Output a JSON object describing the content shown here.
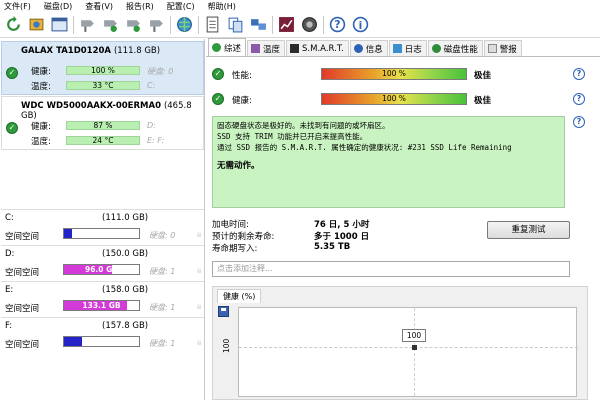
{
  "menu": [
    "文件(F)",
    "磁盘(D)",
    "查看(V)",
    "报告(R)",
    "配置(C)",
    "帮助(H)"
  ],
  "toolbar_icons": [
    "refresh-icon",
    "settings-icon",
    "window-icon",
    "tool1-icon",
    "tool2-icon",
    "tool3-icon",
    "tool4-icon",
    "globe-icon",
    "page-icon",
    "copy-icon",
    "network-icon",
    "chart-icon",
    "camera-icon",
    "help-icon",
    "info-icon"
  ],
  "disks": [
    {
      "name": "GALAX TA1D0120A",
      "size": "(111.8 GB)",
      "health_label": "健康:",
      "health": "100 %",
      "health_value": 100,
      "temp_label": "温度:",
      "temp": "33 °C",
      "note1": "硬盘: 0",
      "note2": "C:"
    },
    {
      "name": "WDC WD5000AAKX-00ERMA0",
      "size": "(465.8 GB)",
      "health_label": "健康:",
      "health": "87 %",
      "health_value": 87,
      "temp_label": "温度:",
      "temp": "24 °C",
      "note1": "D:",
      "note2": "E: F:"
    }
  ],
  "volumes": [
    {
      "letter": "C:",
      "capacity": "(111.0 GB)",
      "free_label": "空间空间",
      "free": "11.8 GB",
      "used_pct": 10,
      "color": "#2323c8",
      "note": "硬盘: 0"
    },
    {
      "letter": "D:",
      "capacity": "(150.0 GB)",
      "free_label": "空间空间",
      "free": "96.0 GB",
      "used_pct": 64,
      "color": "#d43ad8",
      "note": "硬盘: 1"
    },
    {
      "letter": "E:",
      "capacity": "(158.0 GB)",
      "free_label": "空间空间",
      "free": "133.1 GB",
      "used_pct": 84,
      "color": "#d43ad8",
      "note": "硬盘: 1"
    },
    {
      "letter": "F:",
      "capacity": "(157.8 GB)",
      "free_label": "空间空间",
      "free": "38.2 GB",
      "used_pct": 24,
      "color": "#2323c8",
      "note": "硬盘: 1"
    }
  ],
  "tabs": [
    "综述",
    "温度",
    "S.M.A.R.T.",
    "信息",
    "日志",
    "磁盘性能",
    "警报"
  ],
  "performance": {
    "label": "性能:",
    "value": "100 %",
    "level": 100,
    "verdict": "极佳"
  },
  "health": {
    "label": "健康:",
    "value": "100 %",
    "level": 100,
    "verdict": "极佳"
  },
  "message": {
    "line1": "固态硬盘状态是极好的。未找到有问题的或坏扇区。",
    "line2": "SSD 支持 TRIM 功能并已开启来提高性能。",
    "line3": "通过 SSD 报告的 S.M.A.R.T. 属性确定的健康状况:   #231 SSD Life Remaining",
    "action": "无需动作。"
  },
  "info": [
    {
      "label": "加电时间:",
      "value": "76 日, 5 小时"
    },
    {
      "label": "预计的剩余寿命:",
      "value": "多于 1000 日"
    },
    {
      "label": "寿命期写入:",
      "value": "5.35 TB"
    }
  ],
  "retest_button": "重复测试",
  "comment_placeholder": "点击添加注释...",
  "chart_tab": "健康 (%)",
  "chart_data": {
    "type": "line",
    "title": "",
    "ylabel": "",
    "y_tick": "100",
    "series": [
      {
        "values": [
          100
        ],
        "point_label": "100"
      }
    ]
  }
}
